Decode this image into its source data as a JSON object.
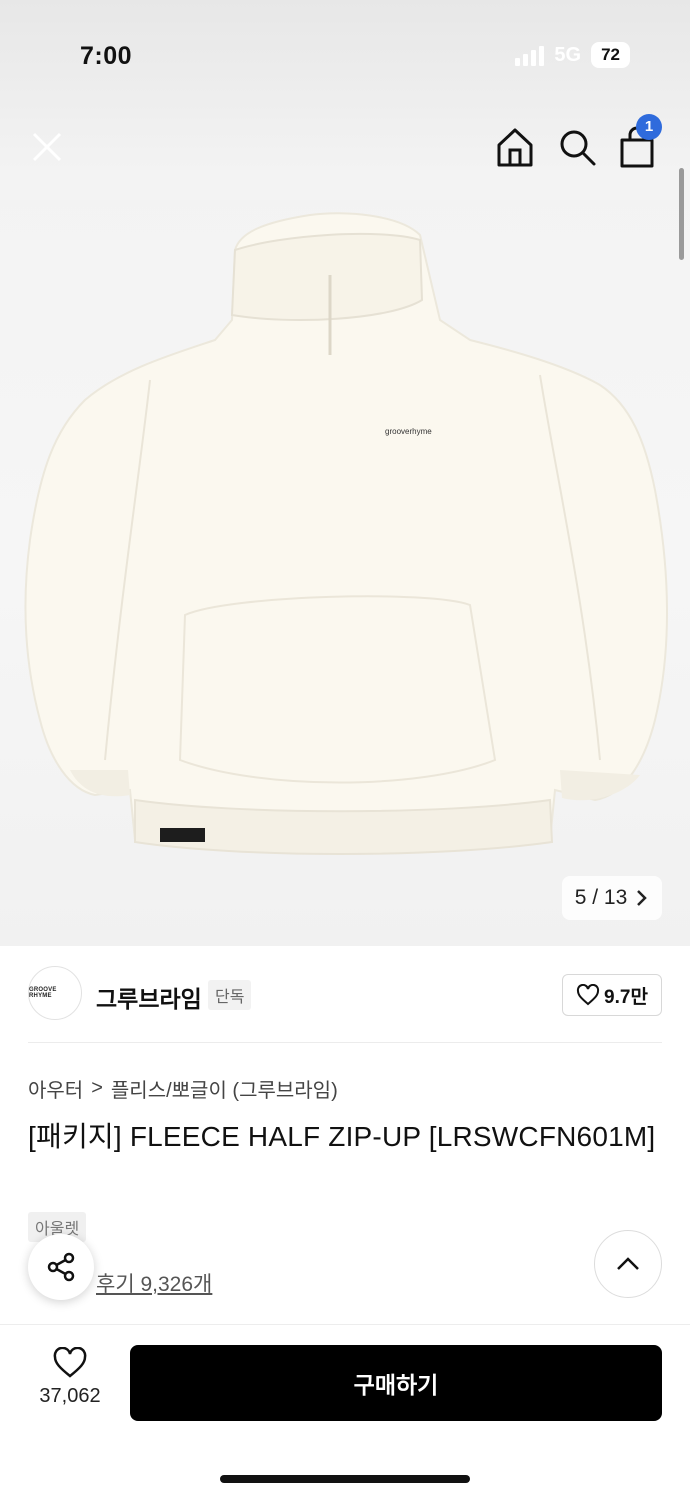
{
  "status": {
    "time": "7:00",
    "network": "5G",
    "battery": "72"
  },
  "header": {
    "close_icon": "close-icon",
    "home_icon": "home-icon",
    "search_icon": "search-icon",
    "bag_icon": "shopping-bag-icon",
    "bag_badge": "1"
  },
  "gallery": {
    "image_label": "grooverhyme",
    "counter": "5 / 13",
    "next_icon": "chevron-right-icon"
  },
  "brand": {
    "logo_text": "GROOVE RHYME",
    "name": "그루브라임",
    "tag": "단독",
    "likes": "9.7만",
    "like_icon": "heart-icon"
  },
  "product": {
    "breadcrumb": [
      "아우터",
      "플리스/뽀글이 (그루브라임)"
    ],
    "breadcrumb_separator": ">",
    "title": "[패키지] FLEECE HALF ZIP-UP [LRSWCFN601M]",
    "outlet_tag": "아울렛",
    "review_link": "후기 9,326개"
  },
  "actions": {
    "share_icon": "share-icon",
    "scroll_top_icon": "chevron-up-icon",
    "wish_icon": "heart-outline-icon",
    "wish_count": "37,062",
    "buy_label": "구매하기"
  }
}
